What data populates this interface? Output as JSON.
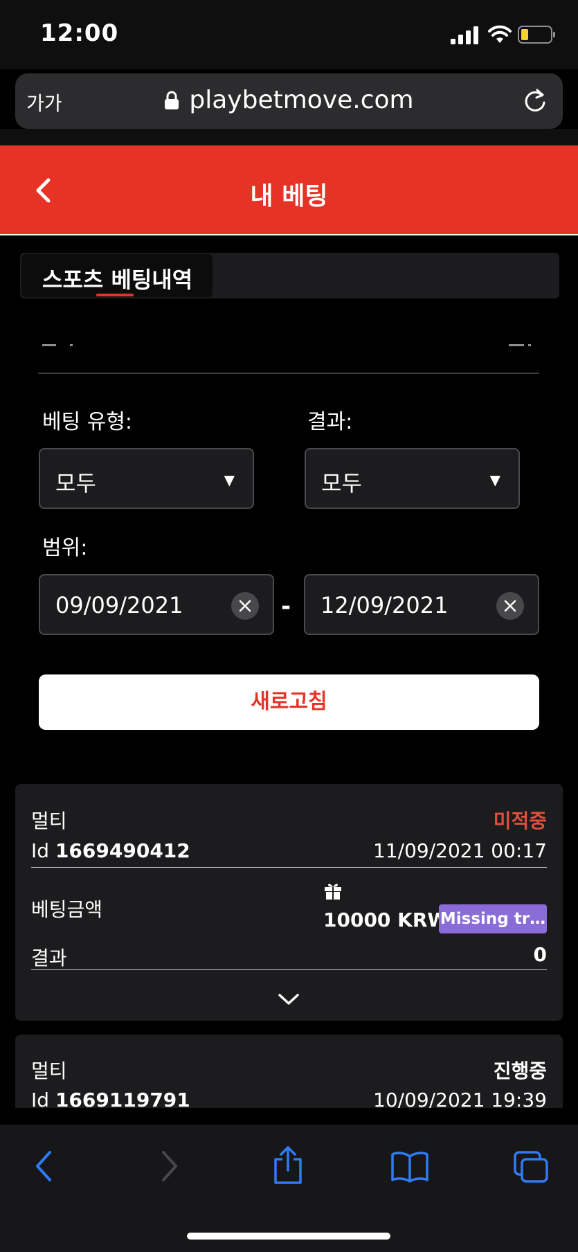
{
  "status_bar": {
    "time": "12:00"
  },
  "browser": {
    "text_size": "가가",
    "url": "playbetmove.com"
  },
  "header": {
    "title": "내 베팅"
  },
  "tabs": [
    {
      "label": "스포츠 베팅내역"
    }
  ],
  "filters": {
    "bet_type_label": "베팅 유형:",
    "bet_type_value": "모두",
    "result_label": "결과:",
    "result_value": "모두",
    "range_label": "범위:",
    "date_from": "09/09/2021",
    "date_separator": "-",
    "date_to": "12/09/2021",
    "refresh_label": "새로고침"
  },
  "bets": [
    {
      "type": "멀티",
      "status": "미적중",
      "status_color": "#e0503d",
      "id_prefix": "Id",
      "id": "1669490412",
      "datetime": "11/09/2021 00:17",
      "amount_label": "베팅금액",
      "amount": "10000 KRW",
      "badge": "Missing tr…",
      "result_label": "결과",
      "result_value": "0"
    },
    {
      "type": "멀티",
      "status": "진행중",
      "status_color": "#ffffff",
      "id_prefix": "Id",
      "id": "1669119791",
      "datetime": "10/09/2021 19:39"
    }
  ],
  "toolbar": {
    "icons": [
      "back-icon",
      "forward-icon",
      "share-icon",
      "bookmarks-icon",
      "tabs-icon"
    ]
  },
  "colors": {
    "accent": "#e63326",
    "badge": "#8a6cd8",
    "ios_blue": "#2f7cf6"
  }
}
